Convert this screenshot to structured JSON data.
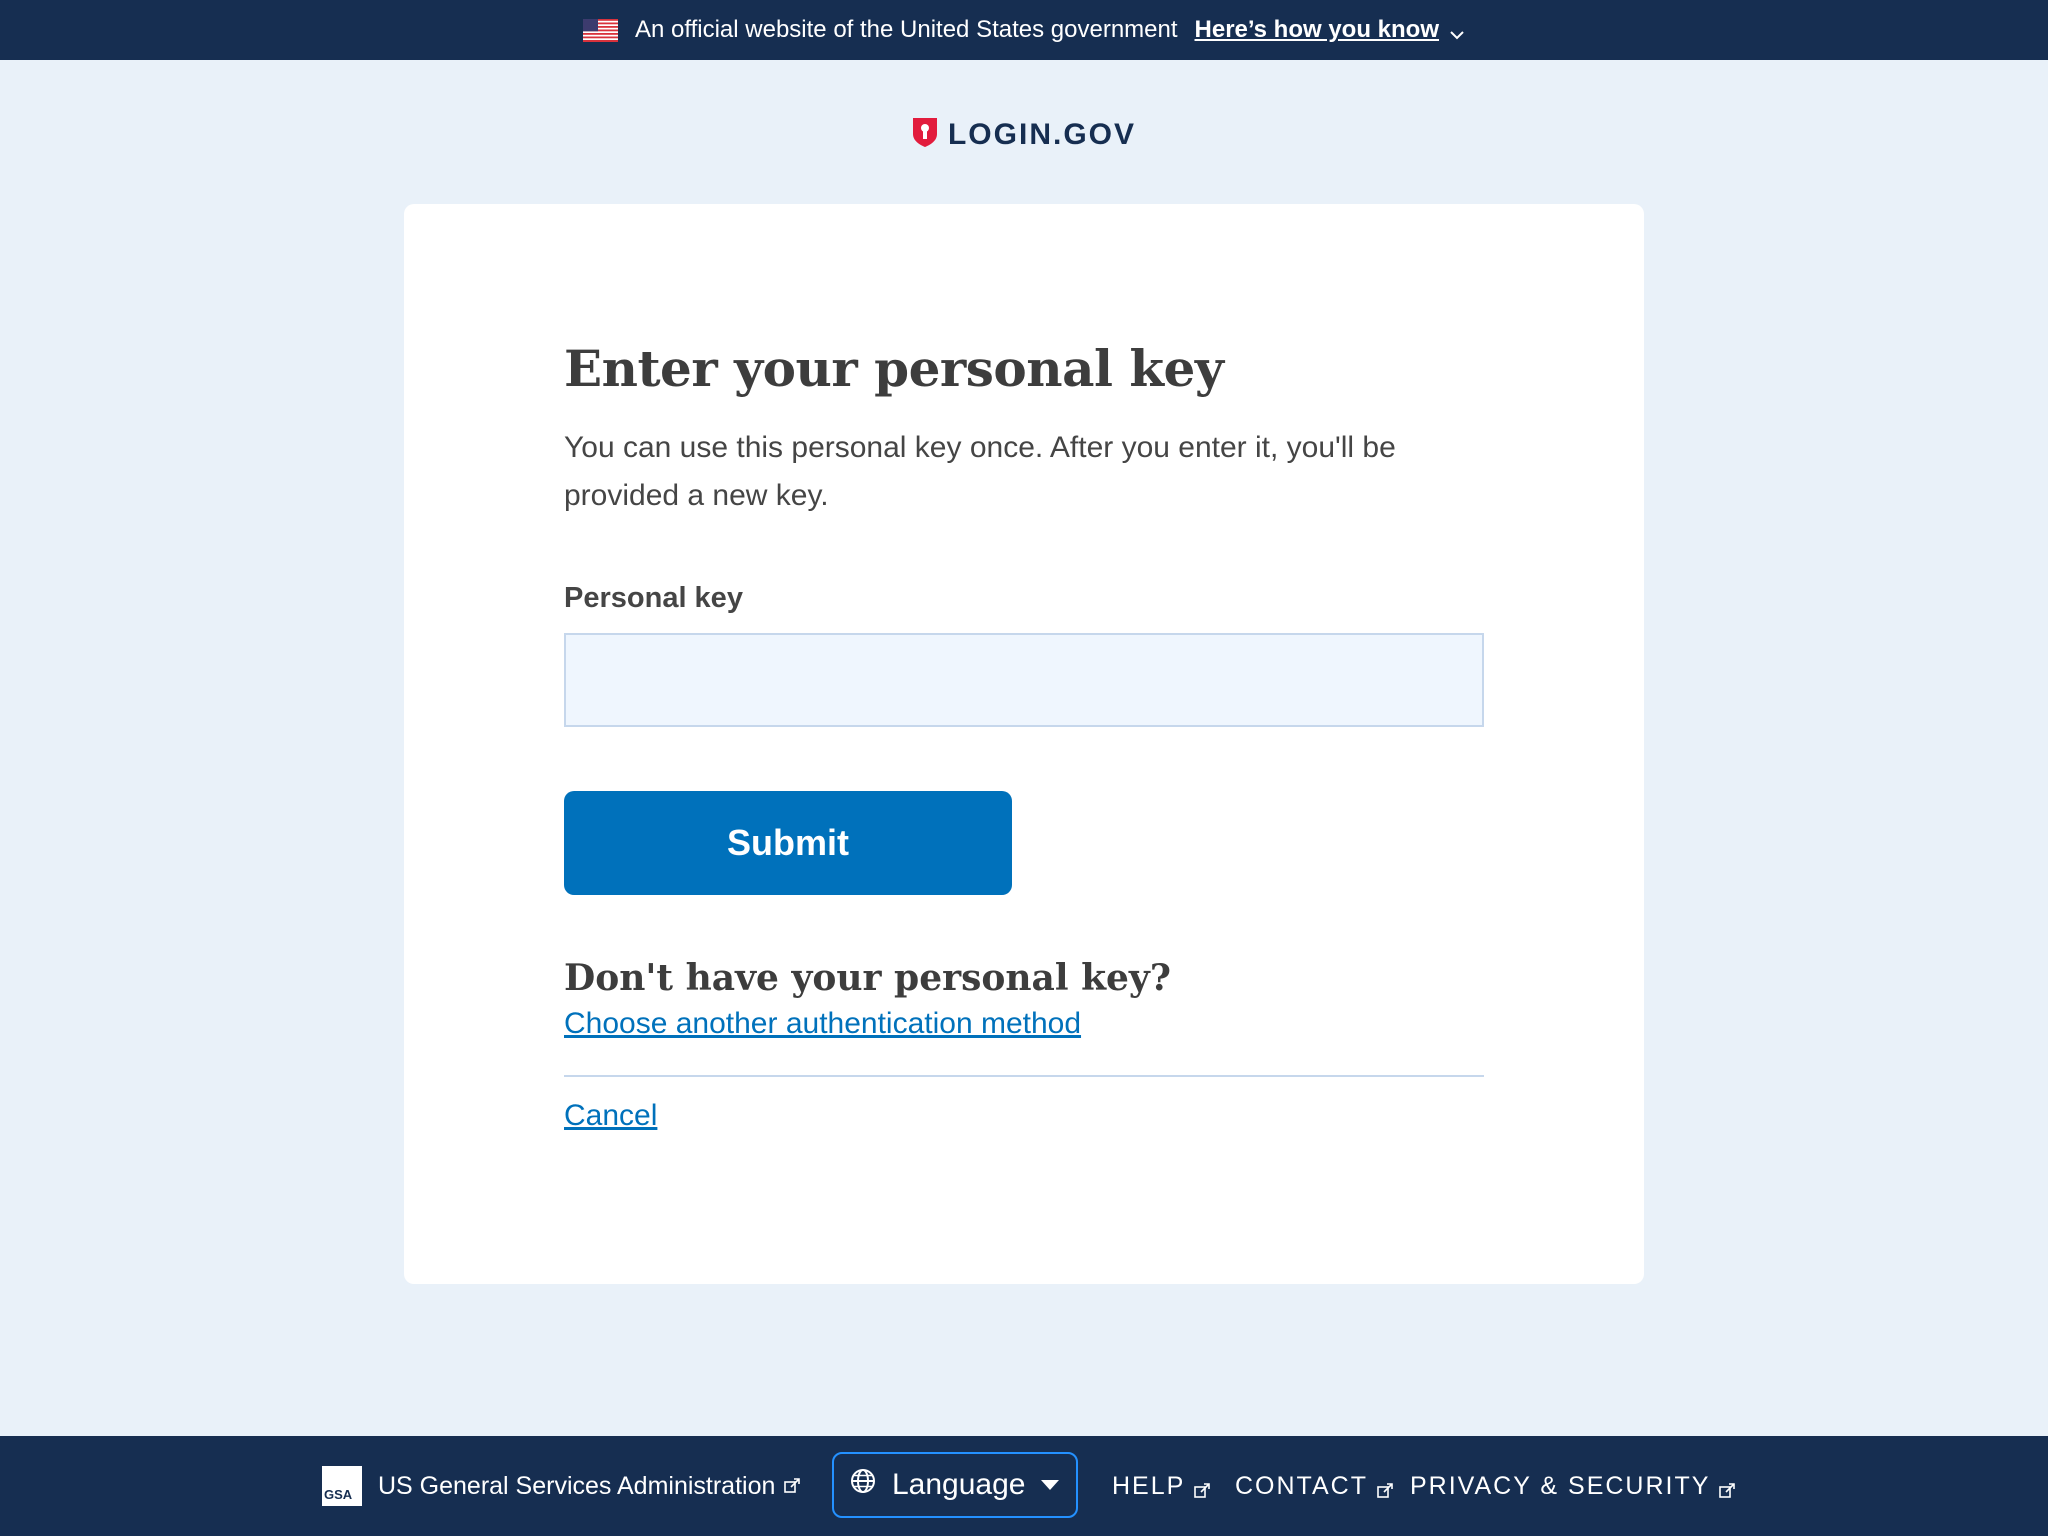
{
  "banner": {
    "text": "An official website of the United States government",
    "link_label": "Here’s how you know"
  },
  "logo": {
    "text": "LOGIN.GOV"
  },
  "form": {
    "title": "Enter your personal key",
    "intro": "You can use this personal key once. After you enter it, you'll be provided a new key.",
    "field_label": "Personal key",
    "field_value": "",
    "submit_label": "Submit",
    "subhead": "Don't have your personal key?",
    "alt_link": "Choose another authentication method",
    "cancel_link": "Cancel"
  },
  "footer": {
    "gsa_logo_text": "GSA",
    "gsa_text": "US General Services Administration",
    "language_label": "Language",
    "links": [
      "HELP",
      "CONTACT",
      "PRIVACY & SECURITY"
    ]
  },
  "colors": {
    "banner_bg": "#162e51",
    "page_bg": "#e9f1f9",
    "primary": "#0071bb",
    "logo_red": "#e21c3d"
  },
  "icons": [
    "us-flag-icon",
    "chevron-down-icon",
    "login-shield-icon",
    "external-link-icon",
    "globe-icon",
    "caret-down-icon"
  ]
}
